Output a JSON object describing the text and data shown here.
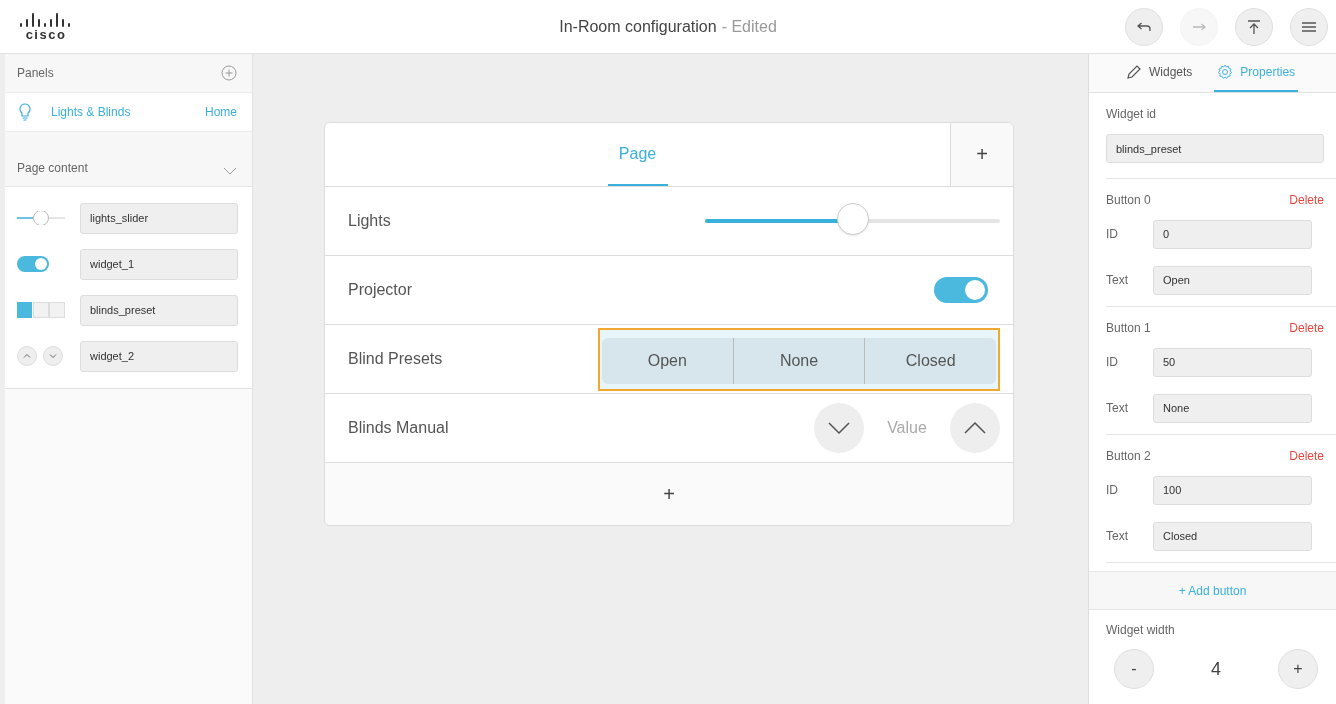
{
  "header": {
    "logo": "cisco",
    "title": "In-Room configuration",
    "status": "- Edited",
    "actions": [
      {
        "kind": "undo",
        "disabled": false
      },
      {
        "kind": "redo",
        "disabled": true
      },
      {
        "kind": "upload",
        "disabled": false
      },
      {
        "kind": "menu",
        "disabled": false
      }
    ]
  },
  "sidebar": {
    "panels_heading": "Panels",
    "panels": [
      {
        "name": "Lights & Blinds",
        "tag": "Home",
        "selected": true
      }
    ],
    "page_content_heading": "Page content",
    "expanded": true,
    "widgets": [
      {
        "kind": "slider",
        "id": "lights_slider"
      },
      {
        "kind": "toggle",
        "id": "widget_1"
      },
      {
        "kind": "group",
        "id": "blinds_preset"
      },
      {
        "kind": "spinner",
        "id": "widget_2"
      }
    ]
  },
  "page": {
    "tabs": [
      {
        "label": "Page",
        "selected": true
      }
    ],
    "add_tab": "+",
    "rows": [
      {
        "kind": "slider",
        "label": "Lights",
        "selected": false,
        "level": 0.5
      },
      {
        "kind": "toggle",
        "label": "Projector",
        "selected": false,
        "on": true
      },
      {
        "kind": "group",
        "label": "Blind Presets",
        "selected": true,
        "options": [
          {
            "text": "Open"
          },
          {
            "text": "None"
          },
          {
            "text": "Closed"
          }
        ]
      },
      {
        "kind": "spinner",
        "label": "Blinds Manual",
        "selected": false,
        "value": "Value"
      }
    ],
    "add_row": "+"
  },
  "inspector": {
    "tabs": [
      {
        "kind": "widgets",
        "label": "Widgets",
        "selected": false
      },
      {
        "kind": "properties",
        "label": "Properties",
        "selected": true
      }
    ],
    "widget_id_label": "Widget id",
    "widget_id": "blinds_preset",
    "buttons": [
      {
        "title": "Button 0",
        "delete": "Delete",
        "id_label": "ID",
        "id": "0",
        "text_label": "Text",
        "text": "Open"
      },
      {
        "title": "Button 1",
        "delete": "Delete",
        "id_label": "ID",
        "id": "50",
        "text_label": "Text",
        "text": "None"
      },
      {
        "title": "Button 2",
        "delete": "Delete",
        "id_label": "ID",
        "id": "100",
        "text_label": "Text",
        "text": "Closed"
      }
    ],
    "add_button": "+ Add button",
    "width_label": "Widget width",
    "width_decrease": "-",
    "width_value": "4",
    "width_increase": "+"
  }
}
